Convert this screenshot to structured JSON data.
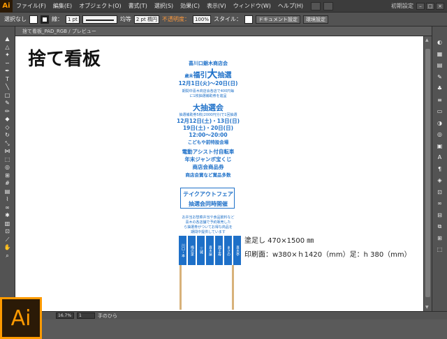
{
  "app": {
    "logo_small": "Ai",
    "logo_big": "Ai",
    "workspace_mode": "初期設定"
  },
  "menu": [
    "ファイル(F)",
    "編集(E)",
    "オブジェクト(O)",
    "書式(T)",
    "選択(S)",
    "効果(C)",
    "表示(V)",
    "ウィンドウ(W)",
    "ヘルプ(H)"
  ],
  "control": {
    "selection": "選択なし",
    "stroke_label": "線：",
    "stroke_weight": "1 pt",
    "line_style": "均等",
    "brush": "2 pt 楕円",
    "opacity_label": "不透明度：",
    "opacity_value": "100%",
    "style_label": "スタイル：",
    "doc_setup": "ドキュメント設定",
    "env_settings": "環境設定"
  },
  "document_tab": "捨て看板_PAD_RGB / プレビュー",
  "artboard": {
    "title": "捨て看板",
    "sign": {
      "assoc": "喜川口銀木商店会",
      "prefix": "歳末",
      "headline_a": "福引",
      "headline_b": "大",
      "headline_c": "抽選",
      "dates1": "12月1日(火)〜20日(日)",
      "rule1": "期間中喜木商店会各店で400円毎",
      "rule2": "に1枚抽選補助券を進呈",
      "big_heading": "大抽選会",
      "rule3": "抽選補助券5枚(2000円分)で1回抽選",
      "dates2": "12月12日(土)・13日(日)",
      "dates3": "19日(土)・20日(日)",
      "time": "12:00〜20:00",
      "venue": "こどもや前特設会場",
      "prize1": "電動アシスト付自転車",
      "prize2": "年末ジャンボ宝くじ",
      "prize3": "商店会商品券",
      "prize4": "商店会賞など賞品多数",
      "box_line1": "テイクアウトフェア",
      "box_line2": "抽選会同時開催",
      "small1": "お弁当お惣菜弁当や食品飲料など",
      "small2": "喜木の各店舗で予約販売した",
      "small3": "ら抽選券がついてお得な商品を",
      "small4": "期間中提供しています",
      "shops": [
        "川口・本",
        "梅の家",
        "三城",
        "喜木屋",
        "鶏王寿",
        "まさの",
        "喜木亭"
      ]
    },
    "note1": "塗足し 470×1500 ㎜",
    "note2": "印刷面：w380×ｈ1420（mm）足：h 380（mm）"
  },
  "status": {
    "zoom": "16.7%",
    "page": "1",
    "tool": "手のひら"
  }
}
